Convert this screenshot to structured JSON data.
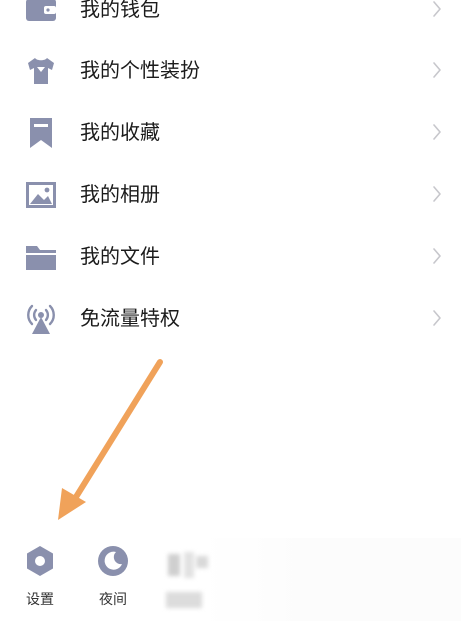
{
  "menu": {
    "items": [
      {
        "label": "我的钱包",
        "icon": "wallet-icon"
      },
      {
        "label": "我的个性装扮",
        "icon": "tshirt-icon"
      },
      {
        "label": "我的收藏",
        "icon": "bookmark-icon"
      },
      {
        "label": "我的相册",
        "icon": "image-icon"
      },
      {
        "label": "我的文件",
        "icon": "folder-icon"
      },
      {
        "label": "免流量特权",
        "icon": "signal-tower-icon"
      }
    ]
  },
  "bottom_bar": {
    "settings_label": "设置",
    "settings_icon": "hexagon-settings-icon",
    "night_label": "夜间",
    "night_icon": "moon-icon"
  },
  "colors": {
    "icon": "#8a90ad",
    "chevron": "#c7c7cc",
    "annotation_arrow": "#f0a25a",
    "text": "#1b1b1b"
  }
}
